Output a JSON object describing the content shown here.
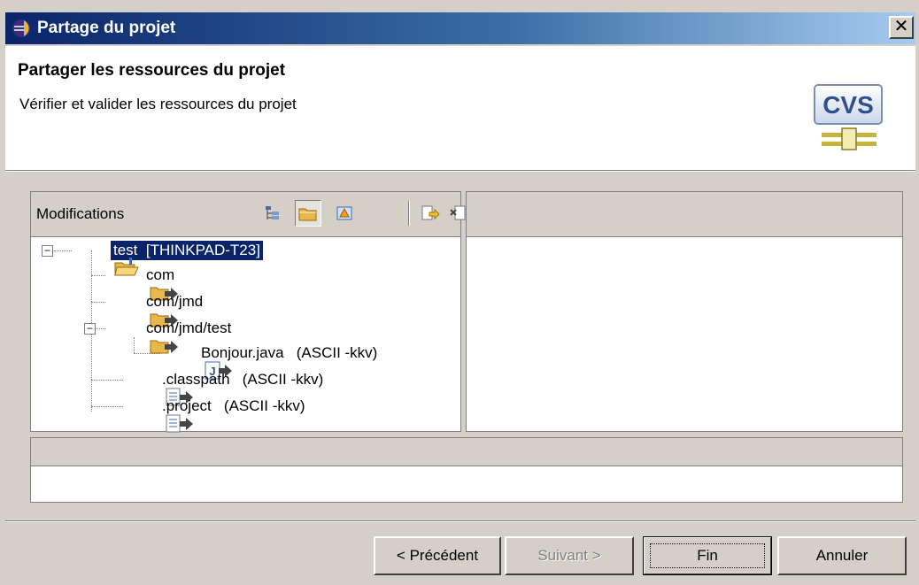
{
  "window": {
    "title": "Partage du projet",
    "close_label": "✕"
  },
  "banner": {
    "heading": "Partager les ressources du projet",
    "description": "Vérifier et valider les ressources du projet",
    "logo_text": "CVS"
  },
  "changes_pane": {
    "label": "Modifications",
    "toolbar_icons": [
      "tree-layout-icon",
      "compressed-folders-icon",
      "model-sync-icon",
      "commit-icon",
      "ignore-icon"
    ],
    "tree": [
      {
        "text": "test  [THINKPAD-T23]",
        "icon": "project-folder-icon",
        "selected": true
      },
      {
        "text": "com",
        "icon": "outgoing-folder-icon"
      },
      {
        "text": "com/jmd",
        "icon": "outgoing-folder-icon"
      },
      {
        "text": "com/jmd/test",
        "icon": "outgoing-folder-icon"
      },
      {
        "text": "Bonjour.java   (ASCII -kkv)",
        "icon": "outgoing-java-file-icon"
      },
      {
        "text": ".classpath   (ASCII -kkv)",
        "icon": "outgoing-file-icon"
      },
      {
        "text": ".project   (ASCII -kkv)",
        "icon": "outgoing-file-icon"
      }
    ]
  },
  "buttons": {
    "back": "< Précédent",
    "next": "Suivant >",
    "finish": "Fin",
    "cancel": "Annuler"
  },
  "colors": {
    "selection": "#0a246a",
    "titlebar_start": "#0a246a",
    "dialog_bg": "#d4d0c8"
  }
}
